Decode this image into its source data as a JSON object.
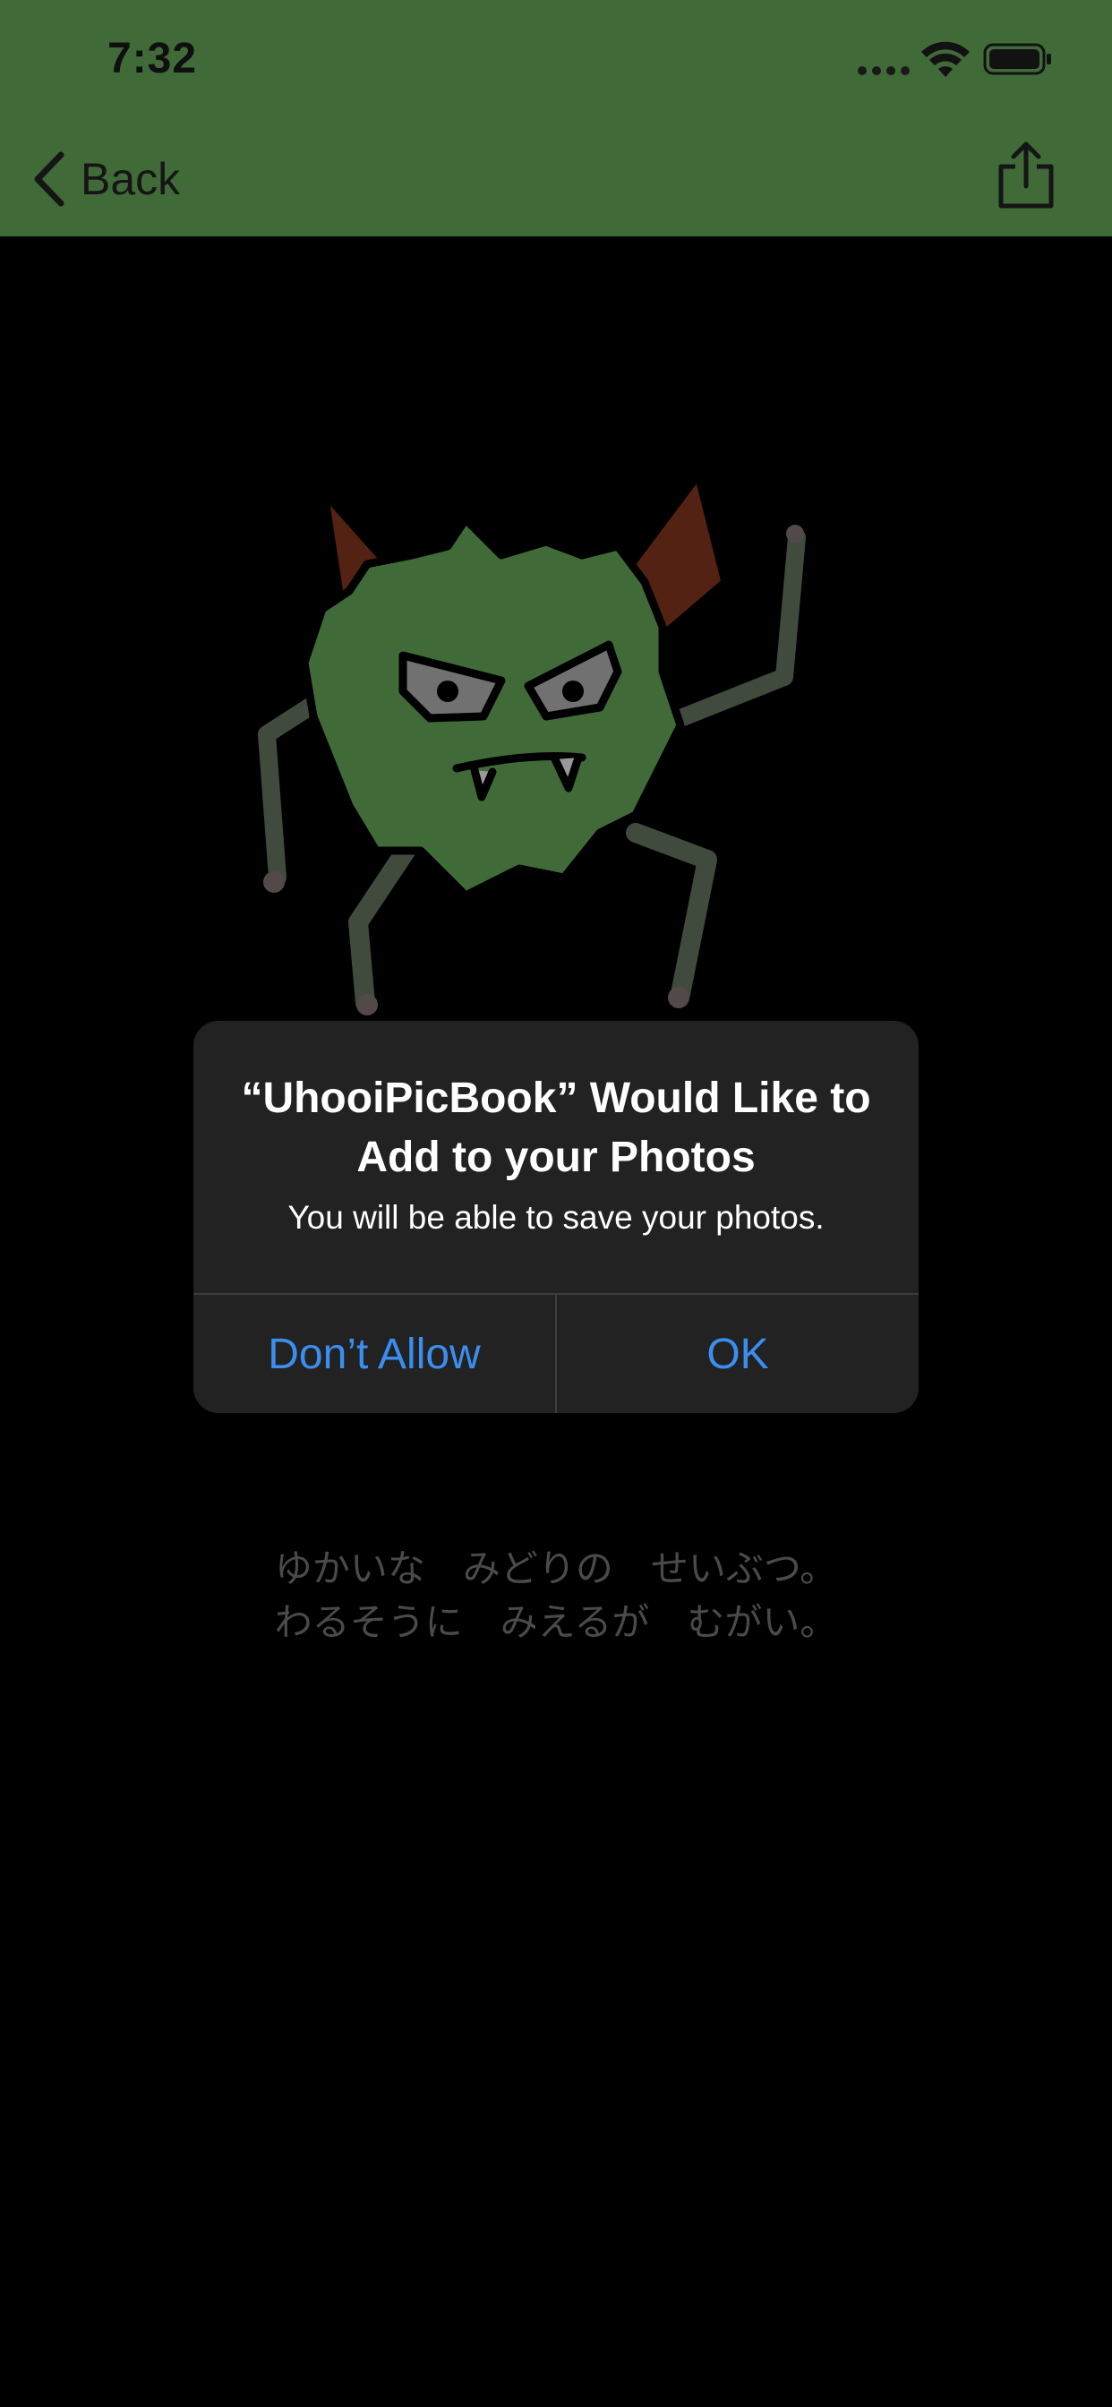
{
  "status_bar": {
    "time": "7:32"
  },
  "nav": {
    "back_label": "Back"
  },
  "caption": {
    "line1": "ゆかいな　みどりの　せいぶつ。",
    "line2": "わるそうに　みえるが　むがい。"
  },
  "alert": {
    "title": "“UhooiPicBook” Would Like to Add to your Photos",
    "message": "You will be able to save your photos.",
    "deny_label": "Don’t Allow",
    "ok_label": "OK"
  },
  "icons": [
    "wifi-icon",
    "battery-icon",
    "chevron-left-icon",
    "share-icon"
  ],
  "colors": {
    "nav_background": "#6bb35f",
    "alert_background": "#222222",
    "alert_button": "#3b8ef0",
    "monster_body": "#6bb35f",
    "monster_horn": "#8b3a1e"
  }
}
